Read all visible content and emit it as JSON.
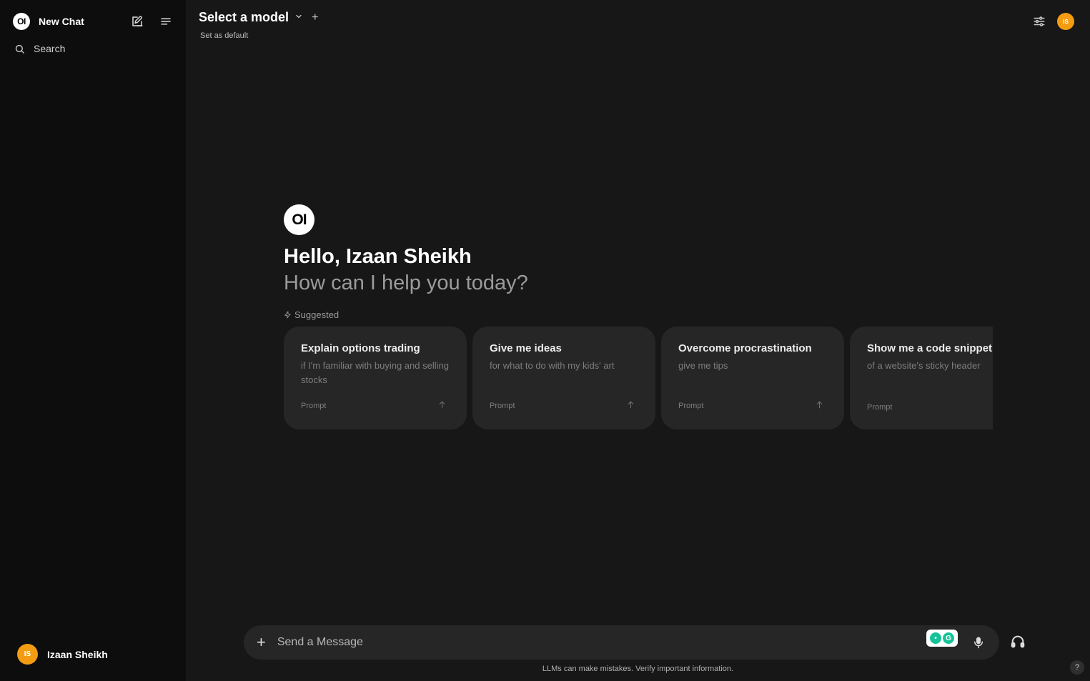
{
  "sidebar": {
    "logo_text": "OI",
    "new_chat_label": "New Chat",
    "search_label": "Search",
    "user": {
      "initials": "IS",
      "name": "Izaan Sheikh"
    }
  },
  "header": {
    "model_title": "Select a model",
    "set_default": "Set as default",
    "user_initials": "IS"
  },
  "welcome": {
    "logo_text": "OI",
    "greeting": "Hello, Izaan Sheikh",
    "subtitle": "How can I help you today?",
    "suggested_label": "Suggested"
  },
  "suggestions": [
    {
      "title": "Explain options trading",
      "subtitle": "if I'm familiar with buying and selling stocks",
      "label": "Prompt"
    },
    {
      "title": "Give me ideas",
      "subtitle": "for what to do with my kids' art",
      "label": "Prompt"
    },
    {
      "title": "Overcome procrastination",
      "subtitle": "give me tips",
      "label": "Prompt"
    },
    {
      "title": "Show me a code snippet",
      "subtitle": "of a website's sticky header",
      "label": "Prompt"
    }
  ],
  "composer": {
    "placeholder": "Send a Message"
  },
  "disclaimer": "LLMs can make mistakes. Verify important information.",
  "help_label": "?",
  "colors": {
    "avatar": "#f39c12",
    "background": "#171717",
    "sidebar": "#0d0d0d",
    "card": "#262626"
  }
}
